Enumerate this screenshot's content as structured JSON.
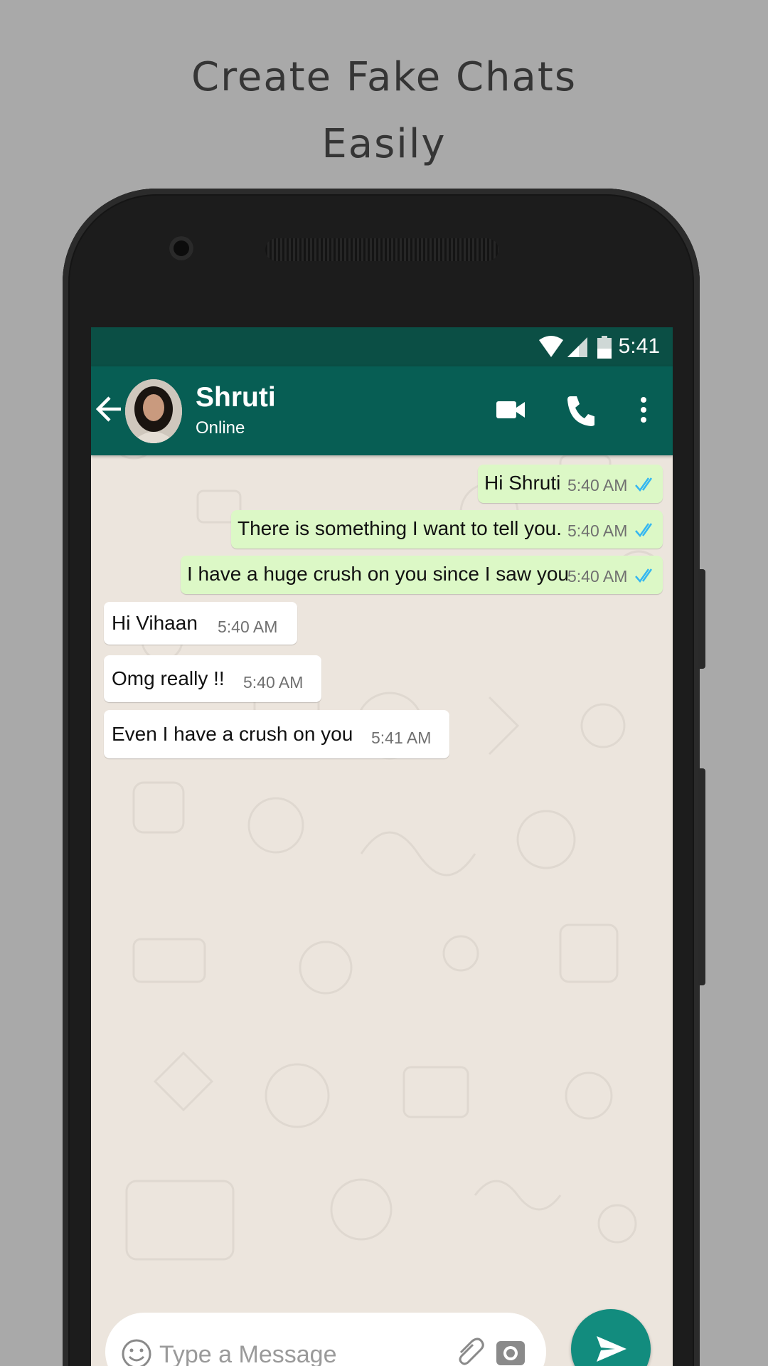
{
  "promo": {
    "line1": "Create Fake Chats",
    "line2": "Easily"
  },
  "status_bar": {
    "time": "5:41",
    "icons": [
      "wifi-icon",
      "signal-icon",
      "battery-icon"
    ]
  },
  "header": {
    "contact_name": "Shruti",
    "presence": "Online",
    "actions": [
      "back-arrow-icon",
      "video-call-icon",
      "phone-icon",
      "more-vert-icon"
    ]
  },
  "messages": [
    {
      "direction": "outgoing",
      "text": "Hi Shruti",
      "time": "5:40 AM",
      "status": "read"
    },
    {
      "direction": "outgoing",
      "text": "There is something I want to tell you.",
      "time": "5:40 AM",
      "status": "read"
    },
    {
      "direction": "outgoing",
      "text": "I have a huge crush on you since I saw you",
      "time": "5:40 AM",
      "status": "read"
    },
    {
      "direction": "incoming",
      "text": "Hi Vihaan",
      "time": "5:40 AM"
    },
    {
      "direction": "incoming",
      "text": "Omg really !!",
      "time": "5:40 AM"
    },
    {
      "direction": "incoming",
      "text": "Even I have a crush on you",
      "time": "5:41 AM"
    }
  ],
  "composer": {
    "placeholder": "Type a Message",
    "icons": [
      "emoji-icon",
      "attach-icon",
      "camera-icon",
      "send-icon"
    ]
  },
  "colors": {
    "toolbar": "#075e54",
    "status_bar": "#0b4f45",
    "outgoing": "#dcf8c6",
    "incoming": "#ffffff",
    "read_tick": "#34b7f1",
    "chat_bg": "#ece5dd",
    "fab": "#128c7e"
  }
}
